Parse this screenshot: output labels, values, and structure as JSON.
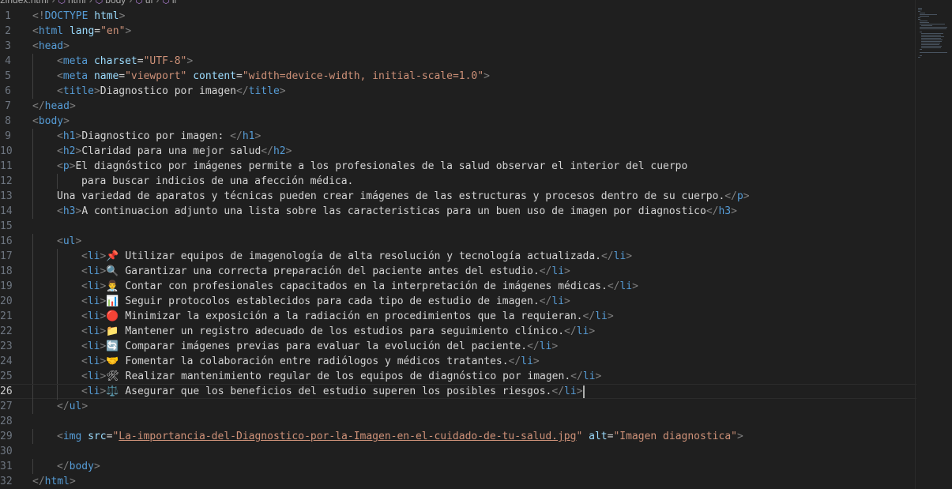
{
  "breadcrumb": [
    "2index.html",
    "html",
    "body",
    "ul",
    "li"
  ],
  "active_line": 26,
  "lines": [
    {
      "n": 1,
      "indent": 0,
      "tokens": [
        [
          "br",
          "<!"
        ],
        [
          "tag",
          "DOCTYPE"
        ],
        [
          "text",
          " "
        ],
        [
          "attr",
          "html"
        ],
        [
          "br",
          ">"
        ]
      ]
    },
    {
      "n": 2,
      "indent": 0,
      "tokens": [
        [
          "br",
          "<"
        ],
        [
          "tag",
          "html"
        ],
        [
          "text",
          " "
        ],
        [
          "attr",
          "lang"
        ],
        [
          "text",
          "="
        ],
        [
          "str",
          "\"en\""
        ],
        [
          "br",
          ">"
        ]
      ]
    },
    {
      "n": 3,
      "indent": 0,
      "tokens": [
        [
          "br",
          "<"
        ],
        [
          "tag",
          "head"
        ],
        [
          "br",
          ">"
        ]
      ]
    },
    {
      "n": 4,
      "indent": 1,
      "tokens": [
        [
          "br",
          "<"
        ],
        [
          "tag",
          "meta"
        ],
        [
          "text",
          " "
        ],
        [
          "attr",
          "charset"
        ],
        [
          "text",
          "="
        ],
        [
          "str",
          "\"UTF-8\""
        ],
        [
          "br",
          ">"
        ]
      ]
    },
    {
      "n": 5,
      "indent": 1,
      "tokens": [
        [
          "br",
          "<"
        ],
        [
          "tag",
          "meta"
        ],
        [
          "text",
          " "
        ],
        [
          "attr",
          "name"
        ],
        [
          "text",
          "="
        ],
        [
          "str",
          "\"viewport\""
        ],
        [
          "text",
          " "
        ],
        [
          "attr",
          "content"
        ],
        [
          "text",
          "="
        ],
        [
          "str",
          "\"width=device-width, initial-scale=1.0\""
        ],
        [
          "br",
          ">"
        ]
      ]
    },
    {
      "n": 6,
      "indent": 1,
      "tokens": [
        [
          "br",
          "<"
        ],
        [
          "tag",
          "title"
        ],
        [
          "br",
          ">"
        ],
        [
          "text",
          "Diagnostico por imagen"
        ],
        [
          "br",
          "</"
        ],
        [
          "tag",
          "title"
        ],
        [
          "br",
          ">"
        ]
      ]
    },
    {
      "n": 7,
      "indent": 0,
      "tokens": [
        [
          "br",
          "</"
        ],
        [
          "tag",
          "head"
        ],
        [
          "br",
          ">"
        ]
      ]
    },
    {
      "n": 8,
      "indent": 0,
      "tokens": [
        [
          "br",
          "<"
        ],
        [
          "tag",
          "body"
        ],
        [
          "br",
          ">"
        ]
      ]
    },
    {
      "n": 9,
      "indent": 1,
      "tokens": [
        [
          "br",
          "<"
        ],
        [
          "tag",
          "h1"
        ],
        [
          "br",
          ">"
        ],
        [
          "text",
          "Diagnostico por imagen: "
        ],
        [
          "br",
          "</"
        ],
        [
          "tag",
          "h1"
        ],
        [
          "br",
          ">"
        ]
      ]
    },
    {
      "n": 10,
      "indent": 1,
      "tokens": [
        [
          "br",
          "<"
        ],
        [
          "tag",
          "h2"
        ],
        [
          "br",
          ">"
        ],
        [
          "text",
          "Claridad para una mejor salud"
        ],
        [
          "br",
          "</"
        ],
        [
          "tag",
          "h2"
        ],
        [
          "br",
          ">"
        ]
      ]
    },
    {
      "n": 11,
      "indent": 1,
      "tokens": [
        [
          "br",
          "<"
        ],
        [
          "tag",
          "p"
        ],
        [
          "br",
          ">"
        ],
        [
          "text",
          "El diagnóstico por imágenes permite a los profesionales de la salud observar el interior del cuerpo"
        ]
      ]
    },
    {
      "n": 12,
      "indent": 2,
      "tokens": [
        [
          "text",
          "para buscar indicios de una afección médica."
        ]
      ]
    },
    {
      "n": 13,
      "indent": 1,
      "tokens": [
        [
          "text",
          "Una variedad de aparatos y técnicas pueden crear imágenes de las estructuras y procesos dentro de su cuerpo."
        ],
        [
          "br",
          "</"
        ],
        [
          "tag",
          "p"
        ],
        [
          "br",
          ">"
        ]
      ]
    },
    {
      "n": 14,
      "indent": 1,
      "tokens": [
        [
          "br",
          "<"
        ],
        [
          "tag",
          "h3"
        ],
        [
          "br",
          ">"
        ],
        [
          "text",
          "A continuacion adjunto una lista sobre las caracteristicas para un buen uso de imagen por diagnostico"
        ],
        [
          "br",
          "</"
        ],
        [
          "tag",
          "h3"
        ],
        [
          "br",
          ">"
        ]
      ]
    },
    {
      "n": 15,
      "indent": 0,
      "tokens": []
    },
    {
      "n": 16,
      "indent": 1,
      "tokens": [
        [
          "br",
          "<"
        ],
        [
          "tag",
          "ul"
        ],
        [
          "br",
          ">"
        ]
      ]
    },
    {
      "n": 17,
      "indent": 2,
      "tokens": [
        [
          "br",
          "<"
        ],
        [
          "tag",
          "li"
        ],
        [
          "br",
          ">"
        ],
        [
          "text",
          "📌 Utilizar equipos de imagenología de alta resolución y tecnología actualizada."
        ],
        [
          "br",
          "</"
        ],
        [
          "tag",
          "li"
        ],
        [
          "br",
          ">"
        ]
      ]
    },
    {
      "n": 18,
      "indent": 2,
      "tokens": [
        [
          "br",
          "<"
        ],
        [
          "tag",
          "li"
        ],
        [
          "br",
          ">"
        ],
        [
          "text",
          "🔍 Garantizar una correcta preparación del paciente antes del estudio."
        ],
        [
          "br",
          "</"
        ],
        [
          "tag",
          "li"
        ],
        [
          "br",
          ">"
        ]
      ]
    },
    {
      "n": 19,
      "indent": 2,
      "tokens": [
        [
          "br",
          "<"
        ],
        [
          "tag",
          "li"
        ],
        [
          "br",
          ">"
        ],
        [
          "text",
          "👨‍⚕️ Contar con profesionales capacitados en la interpretación de imágenes médicas."
        ],
        [
          "br",
          "</"
        ],
        [
          "tag",
          "li"
        ],
        [
          "br",
          ">"
        ]
      ]
    },
    {
      "n": 20,
      "indent": 2,
      "tokens": [
        [
          "br",
          "<"
        ],
        [
          "tag",
          "li"
        ],
        [
          "br",
          ">"
        ],
        [
          "text",
          "📊 Seguir protocolos establecidos para cada tipo de estudio de imagen."
        ],
        [
          "br",
          "</"
        ],
        [
          "tag",
          "li"
        ],
        [
          "br",
          ">"
        ]
      ]
    },
    {
      "n": 21,
      "indent": 2,
      "tokens": [
        [
          "br",
          "<"
        ],
        [
          "tag",
          "li"
        ],
        [
          "br",
          ">"
        ],
        [
          "text",
          "🔴 Minimizar la exposición a la radiación en procedimientos que la requieran."
        ],
        [
          "br",
          "</"
        ],
        [
          "tag",
          "li"
        ],
        [
          "br",
          ">"
        ]
      ]
    },
    {
      "n": 22,
      "indent": 2,
      "tokens": [
        [
          "br",
          "<"
        ],
        [
          "tag",
          "li"
        ],
        [
          "br",
          ">"
        ],
        [
          "text",
          "📁 Mantener un registro adecuado de los estudios para seguimiento clínico."
        ],
        [
          "br",
          "</"
        ],
        [
          "tag",
          "li"
        ],
        [
          "br",
          ">"
        ]
      ]
    },
    {
      "n": 23,
      "indent": 2,
      "tokens": [
        [
          "br",
          "<"
        ],
        [
          "tag",
          "li"
        ],
        [
          "br",
          ">"
        ],
        [
          "text",
          "🔄 Comparar imágenes previas para evaluar la evolución del paciente."
        ],
        [
          "br",
          "</"
        ],
        [
          "tag",
          "li"
        ],
        [
          "br",
          ">"
        ]
      ]
    },
    {
      "n": 24,
      "indent": 2,
      "tokens": [
        [
          "br",
          "<"
        ],
        [
          "tag",
          "li"
        ],
        [
          "br",
          ">"
        ],
        [
          "text",
          "🤝 Fomentar la colaboración entre radiólogos y médicos tratantes."
        ],
        [
          "br",
          "</"
        ],
        [
          "tag",
          "li"
        ],
        [
          "br",
          ">"
        ]
      ]
    },
    {
      "n": 25,
      "indent": 2,
      "tokens": [
        [
          "br",
          "<"
        ],
        [
          "tag",
          "li"
        ],
        [
          "br",
          ">"
        ],
        [
          "text",
          "🛠 Realizar mantenimiento regular de los equipos de diagnóstico por imagen."
        ],
        [
          "br",
          "</"
        ],
        [
          "tag",
          "li"
        ],
        [
          "br",
          ">"
        ]
      ]
    },
    {
      "n": 26,
      "indent": 2,
      "tokens": [
        [
          "br",
          "<"
        ],
        [
          "tag",
          "li"
        ],
        [
          "br",
          ">"
        ],
        [
          "text",
          "⚖️ Asegurar que los beneficios del estudio superen los posibles riesgos."
        ],
        [
          "br",
          "</"
        ],
        [
          "tag",
          "li"
        ],
        [
          "br",
          ">"
        ]
      ]
    },
    {
      "n": 27,
      "indent": 1,
      "tokens": [
        [
          "br",
          "</"
        ],
        [
          "tag",
          "ul"
        ],
        [
          "br",
          ">"
        ]
      ]
    },
    {
      "n": 28,
      "indent": 0,
      "tokens": []
    },
    {
      "n": 29,
      "indent": 1,
      "tokens": [
        [
          "br",
          "<"
        ],
        [
          "tag",
          "img"
        ],
        [
          "text",
          " "
        ],
        [
          "attr",
          "src"
        ],
        [
          "text",
          "="
        ],
        [
          "str",
          "\""
        ],
        [
          "link",
          "La-importancia-del-Diagnostico-por-la-Imagen-en-el-cuidado-de-tu-salud.jpg"
        ],
        [
          "str",
          "\""
        ],
        [
          "text",
          " "
        ],
        [
          "attr",
          "alt"
        ],
        [
          "text",
          "="
        ],
        [
          "str",
          "\"Imagen diagnostica\""
        ],
        [
          "br",
          ">"
        ]
      ]
    },
    {
      "n": 30,
      "indent": 0,
      "tokens": []
    },
    {
      "n": 31,
      "indent": 1,
      "tokens": [
        [
          "br",
          "</"
        ],
        [
          "tag",
          "body"
        ],
        [
          "br",
          ">"
        ]
      ]
    },
    {
      "n": 32,
      "indent": 0,
      "tokens": [
        [
          "br",
          "</"
        ],
        [
          "tag",
          "html"
        ],
        [
          "br",
          ">"
        ]
      ]
    }
  ]
}
